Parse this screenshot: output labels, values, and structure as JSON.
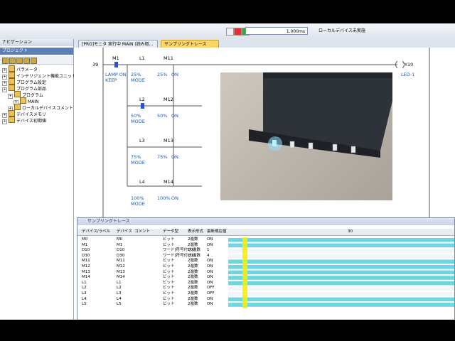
{
  "toolbar": {
    "interval_value": "1.000ms",
    "mode_label": "ローカルデバイス未実施"
  },
  "nav": {
    "header": "ナビゲーション",
    "sub_header": "プロジェクト",
    "items": [
      {
        "label": "パラメータ",
        "level": 0
      },
      {
        "label": "インテリジェント機能ユニット",
        "level": 0
      },
      {
        "label": "プログラム設定",
        "level": 0
      },
      {
        "label": "プログラム部品",
        "level": 0
      },
      {
        "label": "プログラム",
        "level": 1
      },
      {
        "label": "MAIN",
        "level": 2
      },
      {
        "label": "ローカルデバイスコメント",
        "level": 1
      },
      {
        "label": "デバイスメモリ",
        "level": 0
      },
      {
        "label": "デバイス初期値",
        "level": 0
      }
    ]
  },
  "tabs": [
    {
      "label": "[PRG]モニタ 実行中 MAIN (読み取...",
      "active": false
    },
    {
      "label": "サンプリングトレース",
      "active": true
    }
  ],
  "ladder": {
    "step": "39",
    "coil_device": "Y10",
    "coil_comment": "LED-1",
    "rungs": [
      {
        "a_dev": "M1",
        "b_dev": "L1",
        "c_dev": "M11",
        "b_text": "25%",
        "b_text2": "MODE",
        "c_text": "25%",
        "c_state": "ON"
      },
      {
        "a_dev": "",
        "b_dev": "L2",
        "c_dev": "M12",
        "b_text": "50%",
        "b_text2": "MODE",
        "c_text": "50%",
        "c_state": "ON"
      },
      {
        "a_dev": "",
        "b_dev": "L3",
        "c_dev": "M13",
        "b_text": "75%",
        "b_text2": "MODE",
        "c_text": "75%",
        "c_state": "ON"
      },
      {
        "a_dev": "",
        "b_dev": "L4",
        "c_dev": "M14",
        "b_text": "100%",
        "b_text2": "MODE",
        "c_text": "100%",
        "c_state": "ON"
      }
    ],
    "m1_comment": "LAMP ON",
    "m1_comment2": "KEEP"
  },
  "trace": {
    "title": "サンプリングトレース",
    "headers": [
      "デバイス/ラベル",
      "デバイス",
      "コメント",
      "データ型",
      "表示形式",
      "最新現在値"
    ],
    "scale_label": "30",
    "rows": [
      {
        "label": "M0",
        "device": "M0",
        "type": "ビット",
        "fmt": "2進数",
        "value": "ON"
      },
      {
        "label": "M1",
        "device": "M1",
        "type": "ビット",
        "fmt": "2進数",
        "value": "ON"
      },
      {
        "label": "D10",
        "device": "D10",
        "type": "ワード[符号付き]",
        "fmt": "10進数",
        "value": "1"
      },
      {
        "label": "D30",
        "device": "D30",
        "type": "ワード[符号付き]",
        "fmt": "10進数",
        "value": "4"
      },
      {
        "label": "M11",
        "device": "M11",
        "type": "ビット",
        "fmt": "2進数",
        "value": "ON"
      },
      {
        "label": "M12",
        "device": "M12",
        "type": "ビット",
        "fmt": "2進数",
        "value": "ON"
      },
      {
        "label": "M13",
        "device": "M13",
        "type": "ビット",
        "fmt": "2進数",
        "value": "ON"
      },
      {
        "label": "M14",
        "device": "M14",
        "type": "ビット",
        "fmt": "2進数",
        "value": "ON"
      },
      {
        "label": "L1",
        "device": "L1",
        "type": "ビット",
        "fmt": "2進数",
        "value": "ON"
      },
      {
        "label": "L2",
        "device": "L2",
        "type": "ビット",
        "fmt": "2進数",
        "value": "OFF"
      },
      {
        "label": "L3",
        "device": "L3",
        "type": "ビット",
        "fmt": "2進数",
        "value": "OFF"
      },
      {
        "label": "L4",
        "device": "L4",
        "type": "ビット",
        "fmt": "2進数",
        "value": "ON"
      },
      {
        "label": "L5",
        "device": "L5",
        "type": "ビット",
        "fmt": "2進数",
        "value": "ON"
      }
    ]
  },
  "colors": {
    "accent": "#5c7fb8",
    "trace_fill": "#6ed6e0",
    "cursor": "#f6f000",
    "ladder_text": "#1e5aa8"
  }
}
